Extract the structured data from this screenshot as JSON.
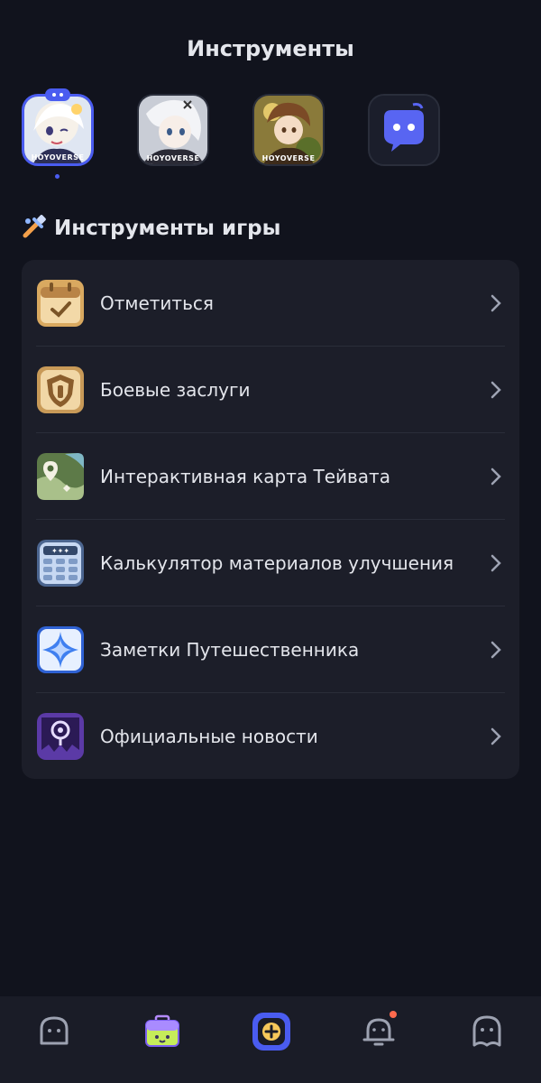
{
  "header": {
    "title": "Инструменты"
  },
  "games": [
    {
      "name": "genshin-game-icon",
      "badge": "HOYOVERSE",
      "active": true
    },
    {
      "name": "honkai-game-icon",
      "badge": "HOYOVERSE",
      "active": false
    },
    {
      "name": "tears-game-icon",
      "badge": "HOYOVERSE",
      "active": false
    },
    {
      "name": "discord-style-game-icon",
      "badge": "",
      "active": false
    }
  ],
  "section": {
    "title": "Инструменты игры",
    "icon": "tools-icon"
  },
  "tools": [
    {
      "label": "Отметиться",
      "icon": "check-in-calendar-icon"
    },
    {
      "label": "Боевые заслуги",
      "icon": "battle-merits-shield-icon"
    },
    {
      "label": "Интерактивная карта Тейвата",
      "icon": "teyvat-map-icon"
    },
    {
      "label": "Калькулятор материалов улучшения",
      "icon": "calculator-icon"
    },
    {
      "label": "Заметки Путешественника",
      "icon": "star-notes-icon"
    },
    {
      "label": "Официальные новости",
      "icon": "news-icon"
    }
  ],
  "tabbar": {
    "items": [
      {
        "name": "home-tab",
        "icon": "ghost-home-icon"
      },
      {
        "name": "toolbox-tab",
        "icon": "toolbox-icon",
        "active": true
      },
      {
        "name": "create-tab",
        "icon": "plus-square-icon"
      },
      {
        "name": "notifications-tab",
        "icon": "bell-icon",
        "has_badge": true
      },
      {
        "name": "profile-tab",
        "icon": "profile-icon"
      }
    ]
  },
  "colors": {
    "background": "#11131d",
    "card": "#1c1e29",
    "accent": "#4a5cf0",
    "badge": "#ff6a4d"
  }
}
